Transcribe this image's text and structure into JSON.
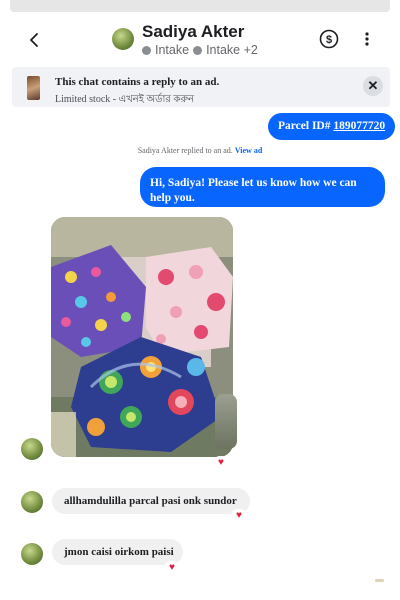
{
  "header": {
    "name": "Sadiya Akter",
    "tag1": "Intake",
    "tag2": "Intake +2"
  },
  "ad_banner": {
    "title": "This chat contains a reply to an ad.",
    "subtitle": "Limited stock - এখনই অর্ডার করুন"
  },
  "messages": {
    "parcel_prefix": "Parcel ID#",
    "parcel_id": "189077720",
    "reply_note": "Sadiya Akter replied to an ad.",
    "view_ad": "View ad",
    "greeting": "Hi, Sadiya! Please let us know how we can help you.",
    "reply_1": "allhamdulilla parcal pasi onk sundor",
    "reply_2": "jmon caisi oirkom paisi"
  },
  "icons": {
    "back": "chevron-left-icon",
    "payment": "dollar-circle-icon",
    "more": "more-vertical-icon",
    "close": "close-icon",
    "reaction": "heart-icon"
  },
  "colors": {
    "accent": "#0866ff",
    "incoming_bubble": "#f0f0f0",
    "banner_bg": "#f0f2f5",
    "heart": "#e41e3f"
  }
}
